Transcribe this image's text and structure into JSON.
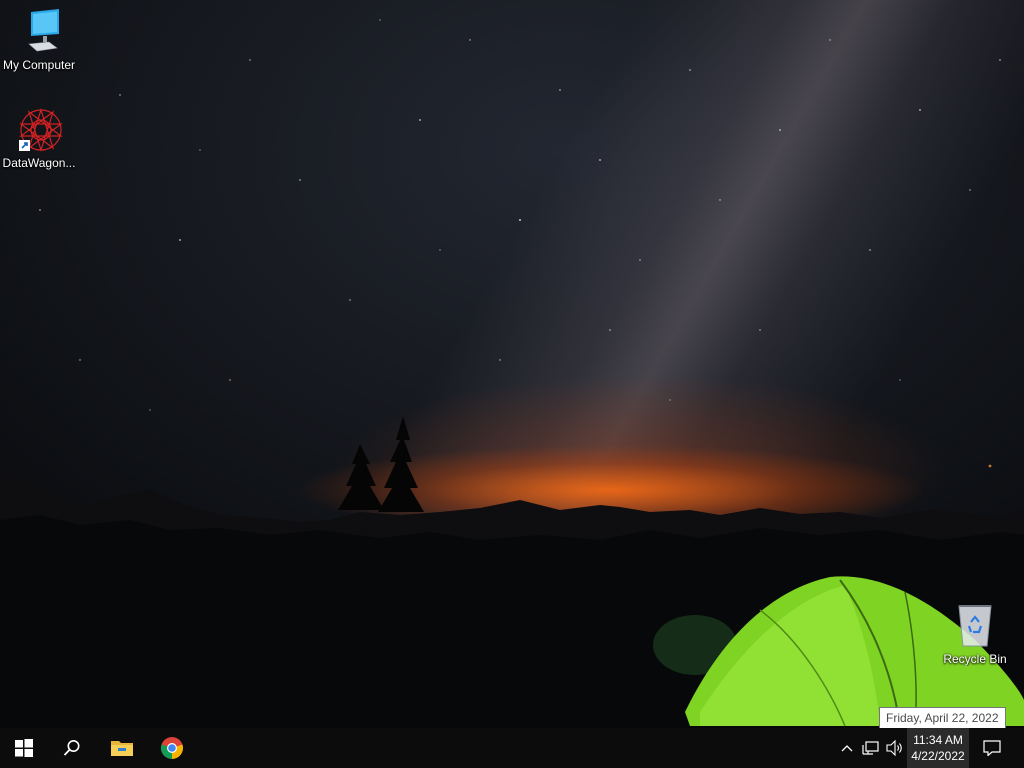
{
  "desktop": {
    "icons": [
      {
        "label": "My Computer",
        "icon": "computer-icon"
      },
      {
        "label": "DataWagon...",
        "icon": "datawagon-app-icon"
      },
      {
        "label": "Recycle Bin",
        "icon": "recycle-bin-icon"
      }
    ]
  },
  "taskbar": {
    "start": {
      "icon": "windows-start-icon"
    },
    "search": {
      "icon": "search-icon"
    },
    "pinned": [
      {
        "icon": "file-explorer-icon"
      },
      {
        "icon": "chrome-icon"
      }
    ],
    "tray": {
      "overflow_icon": "chevron-up-icon",
      "network_icon": "network-icon",
      "volume_icon": "speaker-icon",
      "notification_icon": "action-center-icon"
    },
    "clock": {
      "time": "11:34 AM",
      "date": "4/22/2022",
      "tooltip": "Friday, April 22, 2022"
    }
  }
}
